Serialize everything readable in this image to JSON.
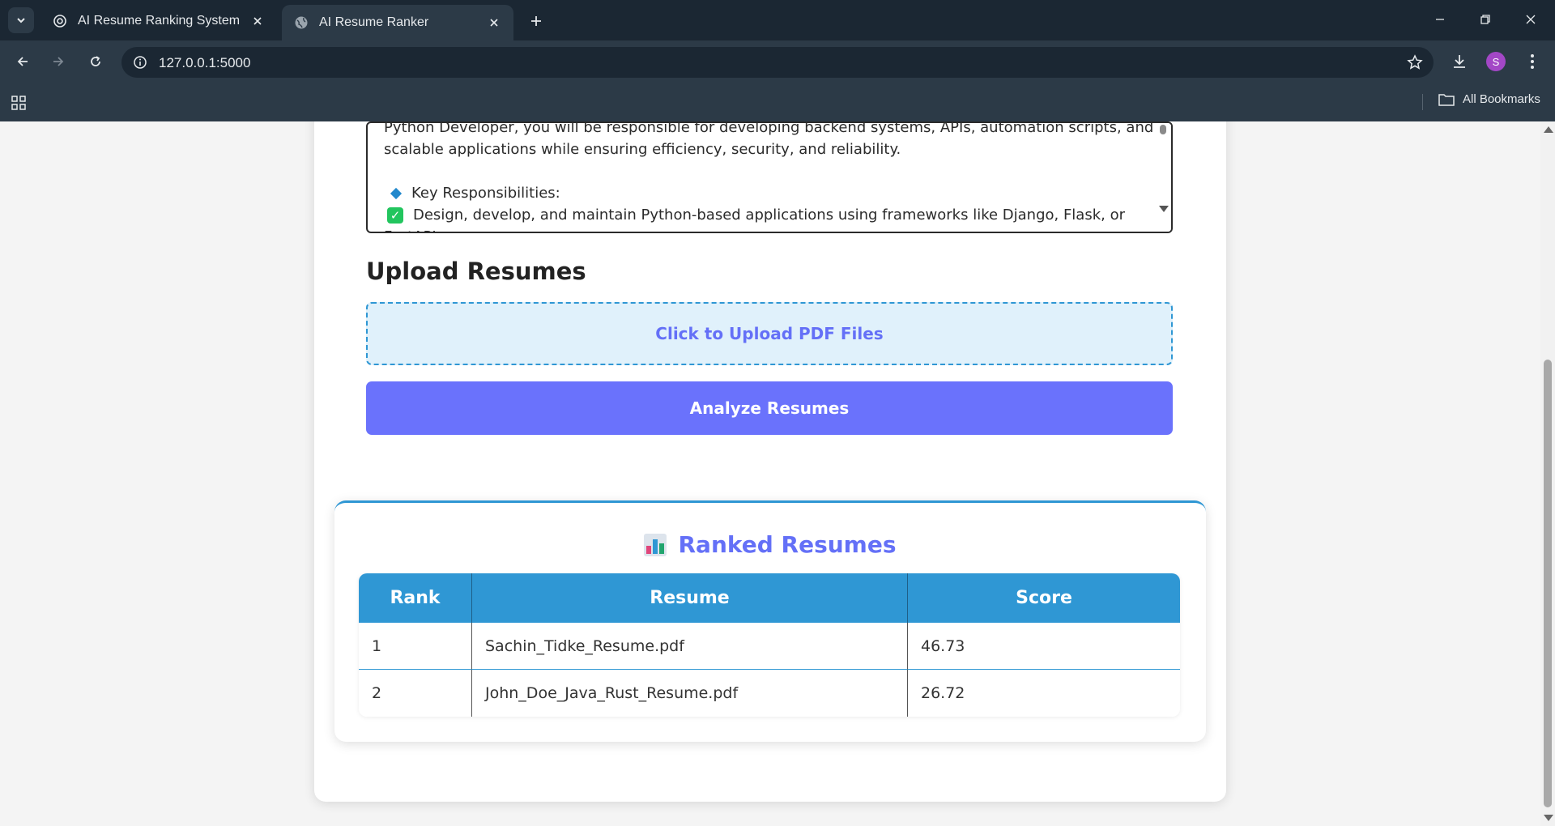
{
  "browser": {
    "tabs": [
      {
        "title": "AI Resume Ranking System",
        "icon": "openai-icon",
        "active": false
      },
      {
        "title": "AI Resume Ranker",
        "icon": "globe-icon",
        "active": true
      }
    ],
    "url": "127.0.0.1:5000",
    "profile_initial": "S",
    "bookmarks_label": "All Bookmarks"
  },
  "job_description": {
    "lines": [
      "Python Developer, you will be responsible for developing backend systems, APIs, automation scripts, and",
      "scalable applications while ensuring efficiency, security, and reliability.",
      "",
      "Key Responsibilities:",
      "Design, develop, and maintain Python-based applications using frameworks like Django, Flask, or",
      "FastAPI"
    ]
  },
  "upload": {
    "heading": "Upload Resumes",
    "dropzone_label": "Click to Upload PDF Files",
    "analyze_label": "Analyze Resumes"
  },
  "results": {
    "title": "Ranked Resumes",
    "columns": [
      "Rank",
      "Resume",
      "Score"
    ],
    "rows": [
      {
        "rank": "1",
        "resume": "Sachin_Tidke_Resume.pdf",
        "score": "46.73"
      },
      {
        "rank": "2",
        "resume": "John_Doe_Java_Rust_Resume.pdf",
        "score": "26.72"
      }
    ]
  },
  "colors": {
    "accent": "#6a72fc",
    "table_header": "#2f97d4",
    "dropzone_bg": "#e0f1fb"
  }
}
